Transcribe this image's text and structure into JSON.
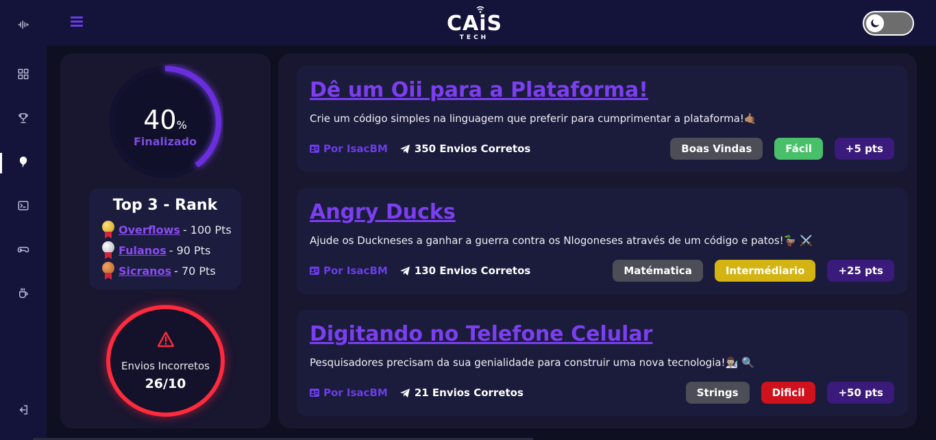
{
  "colors": {
    "background": "#0f0f22",
    "panel": "#191630",
    "card": "#1b1b3c",
    "accent": "#7b3ff0",
    "error": "#ff2a3d",
    "easy": "#48c06a",
    "medium": "#d4b412",
    "hard": "#d0121c"
  },
  "sidebar": {
    "icons": [
      "waveform-icon",
      "grid-icon",
      "trophy-icon",
      "balloon-icon",
      "terminal-icon",
      "gamepad-icon",
      "coffee-icon",
      "logout-icon"
    ],
    "active": "balloon-icon"
  },
  "header": {
    "logo_main": "CAiS",
    "logo_sub": "TECH",
    "theme_toggle": "dark"
  },
  "progress": {
    "value": 40,
    "percent_sign": "%",
    "label": "Finalizado"
  },
  "rank": {
    "title": "Top 3 - Rank",
    "entries": [
      {
        "medal": "gold",
        "name": "Overflows",
        "points": "- 100 Pts"
      },
      {
        "medal": "silver",
        "name": "Fulanos",
        "points": "- 90 Pts"
      },
      {
        "medal": "bronze",
        "name": "Sicranos",
        "points": "- 70 Pts"
      }
    ]
  },
  "errors": {
    "icon": "warning-icon",
    "label": "Envios Incorretos",
    "value": "26/10"
  },
  "challenges": [
    {
      "title": "Dê um Oii para a Plataforma!",
      "description": "Crie um código simples na linguagem que preferir para cumprimentar a plataforma!🤙🏽",
      "author": "Por IsacBM",
      "sends": "350 Envios Corretos",
      "category": "Boas Vindas",
      "difficulty": "Fácil",
      "difficulty_color": "#48c06a",
      "points": "+5 pts"
    },
    {
      "title": "Angry Ducks",
      "description": "Ajude os Duckneses a ganhar a guerra contra os Nlogoneses através de um código e patos!🦆 ⚔️",
      "author": "Por IsacBM",
      "sends": "130 Envios Corretos",
      "category": "Matématica",
      "difficulty": "Intermédiario",
      "difficulty_color": "#d4b412",
      "points": "+25 pts"
    },
    {
      "title": "Digitando no Telefone Celular",
      "description": "Pesquisadores precisam da sua genialidade para construir uma nova tecnologia!👨🏽‍🔬 🔍",
      "author": "Por IsacBM",
      "sends": "21 Envios Corretos",
      "category": "Strings",
      "difficulty": "Dificil",
      "difficulty_color": "#d0121c",
      "points": "+50 pts"
    }
  ]
}
